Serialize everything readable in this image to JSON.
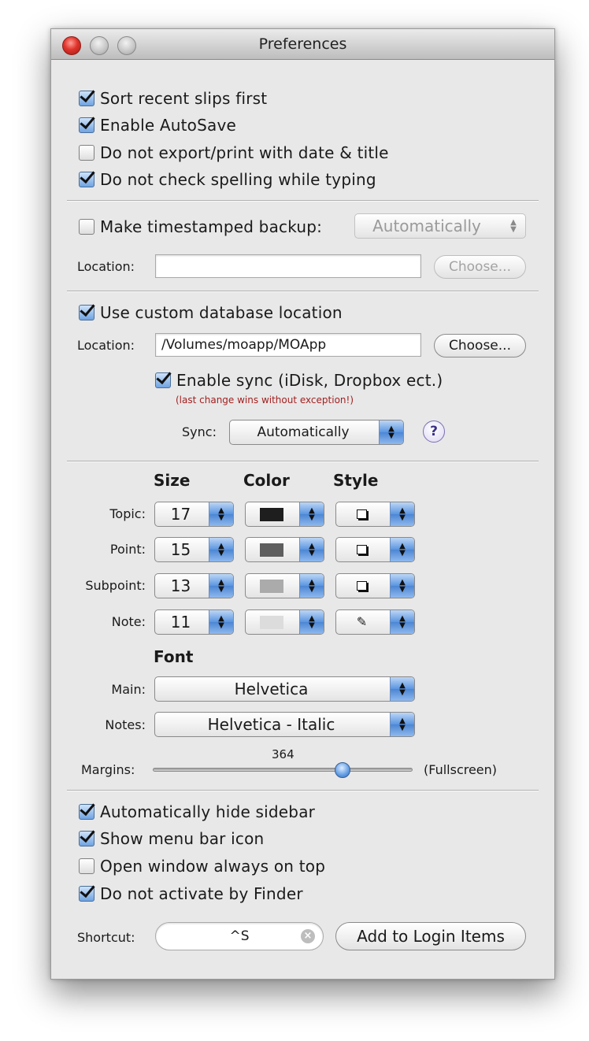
{
  "window": {
    "title": "Preferences"
  },
  "general": {
    "sort_recent": {
      "label": "Sort recent slips first",
      "checked": true
    },
    "autosave": {
      "label": "Enable AutoSave",
      "checked": true
    },
    "no_export_date": {
      "label": "Do not export/print with date & title",
      "checked": false
    },
    "no_spelling": {
      "label": "Do not check spelling while typing",
      "checked": true
    }
  },
  "backup": {
    "label": "Make timestamped backup:",
    "checked": false,
    "frequency": "Automatically",
    "location_label": "Location:",
    "location_value": "",
    "choose_label": "Choose..."
  },
  "database": {
    "label": "Use custom database location",
    "checked": true,
    "location_label": "Location:",
    "location_value": "/Volumes/moapp/MOApp",
    "choose_label": "Choose...",
    "sync_label": "Enable sync (iDisk, Dropbox ect.)",
    "sync_checked": true,
    "sync_warning": "(last change wins without exception!)",
    "sync_mode_label": "Sync:",
    "sync_mode": "Automatically",
    "help_label": "?"
  },
  "format": {
    "headers": {
      "size": "Size",
      "color": "Color",
      "style": "Style"
    },
    "rows": [
      {
        "label": "Topic:",
        "size": "17",
        "color": "#1e1e1e"
      },
      {
        "label": "Point:",
        "size": "15",
        "color": "#5e5e5e"
      },
      {
        "label": "Subpoint:",
        "size": "13",
        "color": "#ababab"
      },
      {
        "label": "Note:",
        "size": "11",
        "color": "#dcdcdc"
      }
    ],
    "font_header": "Font",
    "main_label": "Main:",
    "main_font": "Helvetica",
    "notes_label": "Notes:",
    "notes_font": "Helvetica - Italic",
    "margins_label": "Margins:",
    "margins_value": "364",
    "margins_max_label": "(Fullscreen)",
    "margins_fraction": 0.74
  },
  "misc": {
    "hide_sidebar": {
      "label": "Automatically hide sidebar",
      "checked": true
    },
    "menu_icon": {
      "label": "Show menu bar icon",
      "checked": true
    },
    "always_on_top": {
      "label": "Open window always on top",
      "checked": false
    },
    "no_finder": {
      "label": "Do not activate by Finder",
      "checked": true
    },
    "shortcut_label": "Shortcut:",
    "shortcut_value": "^S",
    "login_button": "Add to Login Items"
  },
  "icons": {
    "checkmark": "checkmark-icon",
    "popup_arrows": "up-down-arrows-icon",
    "clear": "clear-icon",
    "pencil": "pencil-icon",
    "help": "question-mark-icon"
  }
}
